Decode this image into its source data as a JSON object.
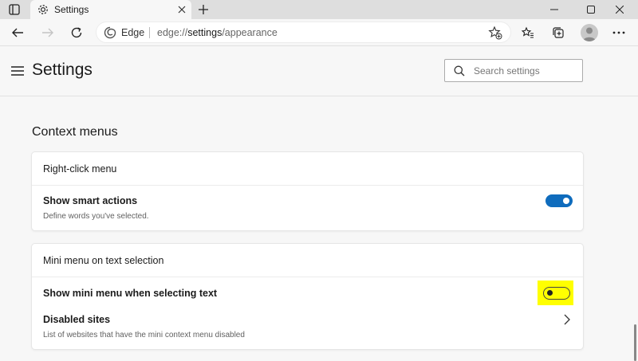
{
  "tab": {
    "title": "Settings"
  },
  "toolbar": {
    "edge_label": "Edge",
    "url_scheme": "edge://",
    "url_strong": "settings",
    "url_path": "/appearance"
  },
  "header": {
    "title": "Settings",
    "search_placeholder": "Search settings"
  },
  "section": {
    "title": "Context menus"
  },
  "right_click_card": {
    "heading": "Right-click menu",
    "smart_actions": {
      "title": "Show smart actions",
      "description": "Define words you've selected.",
      "enabled": true
    }
  },
  "mini_menu_card": {
    "heading": "Mini menu on text selection",
    "show_mini_menu": {
      "title": "Show mini menu when selecting text",
      "enabled": false
    },
    "disabled_sites": {
      "title": "Disabled sites",
      "description": "List of websites that have the mini context menu disabled"
    }
  },
  "colors": {
    "accent": "#0f6cbd",
    "highlight": "#ffff00"
  }
}
